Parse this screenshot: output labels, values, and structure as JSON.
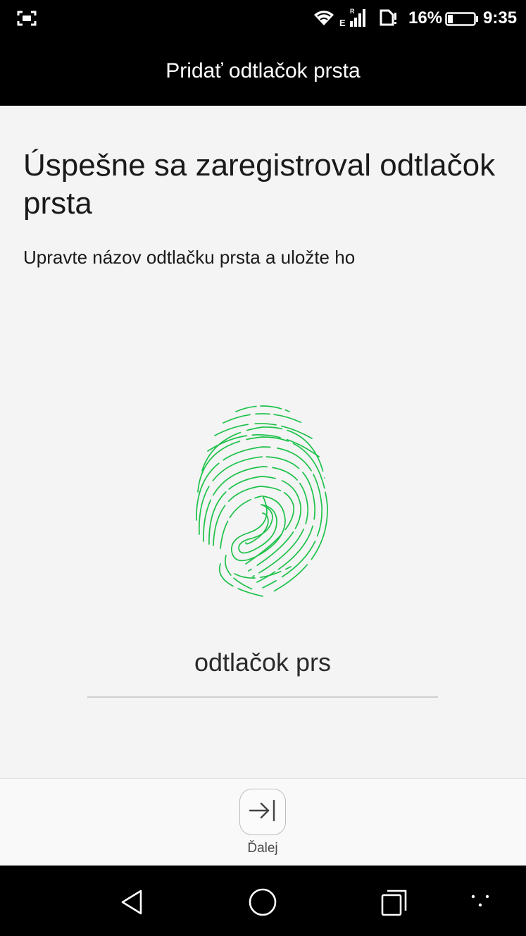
{
  "status_bar": {
    "network_type": "E",
    "roaming_indicator": "R",
    "battery_percent": "16%",
    "time": "9:35",
    "icons": [
      "screenshot-icon",
      "wifi-icon",
      "signal-icon",
      "sim-icon",
      "battery-icon"
    ]
  },
  "title_bar": {
    "title": "Pridať odtlačok prsta"
  },
  "content": {
    "heading": "Úspešne sa zaregistroval odtlačok prsta",
    "subheading": "Upravte názov odtlačku prsta a uložte ho",
    "fingerprint_icon": "fingerprint-icon",
    "fingerprint_color": "#1ec24a",
    "name_value": "odtlačok prs"
  },
  "action_bar": {
    "next_label": "Ďalej",
    "next_icon": "arrow-to-end-icon"
  },
  "nav_bar": {
    "icons": [
      "back-icon",
      "home-icon",
      "recent-apps-icon",
      "more-icon"
    ]
  }
}
